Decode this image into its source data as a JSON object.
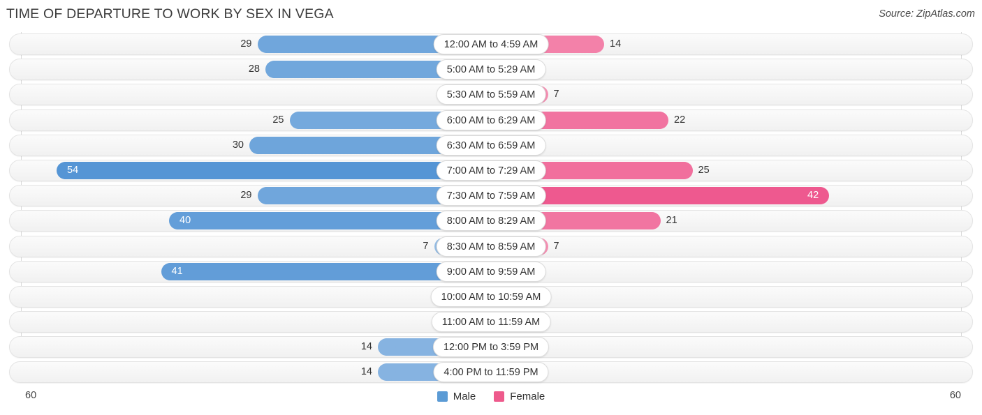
{
  "header": {
    "title": "TIME OF DEPARTURE TO WORK BY SEX IN VEGA",
    "source": "Source: ZipAtlas.com"
  },
  "legend": {
    "male_label": "Male",
    "female_label": "Female",
    "male_color": "#5b9bd5",
    "female_color": "#ee5a8c"
  },
  "axis": {
    "left_end": "60",
    "right_end": "60",
    "max": 60
  },
  "chart_data": {
    "type": "bar",
    "orientation": "horizontal-diverging",
    "title": "TIME OF DEPARTURE TO WORK BY SEX IN VEGA",
    "xlabel": "",
    "ylabel": "",
    "xlim": [
      60,
      60
    ],
    "grid": true,
    "legend_position": "bottom-center",
    "categories": [
      "12:00 AM to 4:59 AM",
      "5:00 AM to 5:29 AM",
      "5:30 AM to 5:59 AM",
      "6:00 AM to 6:29 AM",
      "6:30 AM to 6:59 AM",
      "7:00 AM to 7:29 AM",
      "7:30 AM to 7:59 AM",
      "8:00 AM to 8:29 AM",
      "8:30 AM to 8:59 AM",
      "9:00 AM to 9:59 AM",
      "10:00 AM to 10:59 AM",
      "11:00 AM to 11:59 AM",
      "12:00 PM to 3:59 PM",
      "4:00 PM to 11:59 PM"
    ],
    "series": [
      {
        "name": "Male",
        "color": "#5b9bd5",
        "values": [
          29,
          28,
          4,
          25,
          30,
          54,
          29,
          40,
          7,
          41,
          1,
          0,
          14,
          14
        ]
      },
      {
        "name": "Female",
        "color": "#ee5a8c",
        "values": [
          14,
          0,
          7,
          22,
          3,
          25,
          42,
          21,
          7,
          0,
          0,
          0,
          2,
          5
        ]
      }
    ]
  }
}
